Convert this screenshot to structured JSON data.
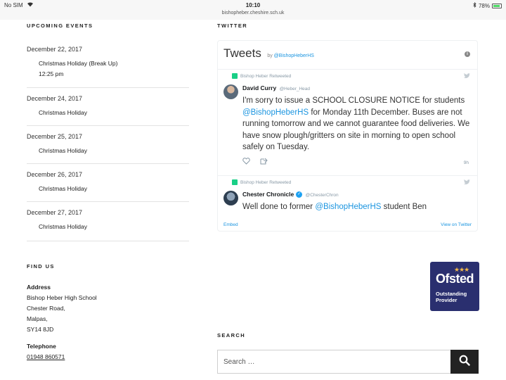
{
  "status_bar": {
    "carrier": "No SIM",
    "wifi_icon": "wifi-icon",
    "time": "10:10",
    "url": "bishopheber.cheshire.sch.uk",
    "battery": "78%",
    "battery_level": 0.78
  },
  "events_section": {
    "heading": "UPCOMING EVENTS",
    "events": [
      {
        "date": "December 22, 2017",
        "title": "Christmas Holiday (Break Up)",
        "time": "12:25 pm"
      },
      {
        "date": "December 24, 2017",
        "title": "Christmas Holiday"
      },
      {
        "date": "December 25, 2017",
        "title": "Christmas Holiday"
      },
      {
        "date": "December 26, 2017",
        "title": "Christmas Holiday"
      },
      {
        "date": "December 27, 2017",
        "title": "Christmas Holiday"
      }
    ]
  },
  "find_us": {
    "heading": "FIND US",
    "address_label": "Address",
    "address_lines": [
      "Bishop Heber High School",
      "Chester Road,",
      "Malpas,",
      "SY14 8JD"
    ],
    "telephone_label": "Telephone",
    "telephone": "01948 860571"
  },
  "twitter": {
    "heading": "TWITTER",
    "title": "Tweets",
    "by": "by",
    "by_handle": "@BishopHeberHS",
    "tweets": [
      {
        "retweeted_by": "Bishop Heber Retweeted",
        "author": "David Curry",
        "handle": "@Heber_Head",
        "verified": false,
        "text_parts": [
          "I'm sorry to issue a SCHOOL CLOSURE NOTICE for students ",
          "@BishopHeberHS",
          " for Monday 11th December. Buses are not running tomorrow and we cannot guarantee food deliveries. We have snow plough/gritters on site in morning to open school safely on Tuesday."
        ],
        "time": "9h"
      },
      {
        "retweeted_by": "Bishop Heber Retweeted",
        "author": "Chester Chronicle",
        "handle": "@ChesterChron",
        "verified": true,
        "text_parts": [
          "Well done to former ",
          "@BishopHeberHS",
          " student Ben"
        ]
      }
    ],
    "embed_label": "Embed",
    "view_label": "View on Twitter"
  },
  "ofsted": {
    "word": "Ofsted",
    "line1": "Outstanding",
    "line2": "Provider",
    "brand_color": "#2a2f6f"
  },
  "search": {
    "heading": "SEARCH",
    "placeholder": "Search …",
    "button_icon": "search-icon"
  }
}
